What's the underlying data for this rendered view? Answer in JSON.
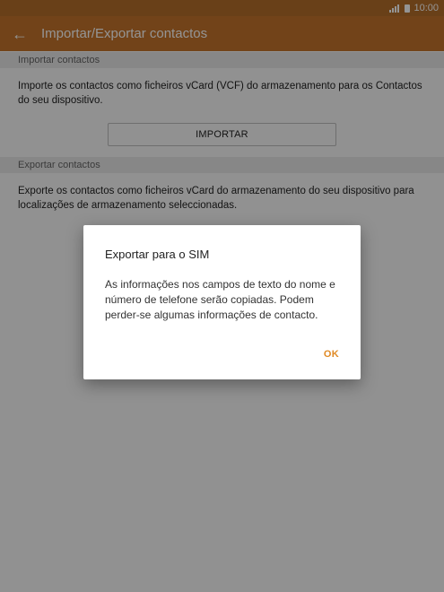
{
  "status_bar": {
    "time": "10:00",
    "signal_icon": "signal-icon",
    "battery_icon": "battery-icon"
  },
  "app_bar": {
    "back_icon": "arrow-left-icon",
    "title": "Importar/Exportar contactos",
    "color": "#c4742b"
  },
  "import_section": {
    "header": "Importar contactos",
    "description": "Importe os contactos como ficheiros vCard (VCF) do armazenamento para os Contactos do seu dispositivo.",
    "button_label": "IMPORTAR"
  },
  "export_section": {
    "header": "Exportar contactos",
    "description": "Exporte os contactos como ficheiros vCard do armazenamento do seu dispositivo para localizações de armazenamento seleccionadas."
  },
  "dialog": {
    "title": "Exportar para o SIM",
    "body": "As informações nos campos de texto do nome e número de telefone serão copiadas. Podem perder-se algumas informações de contacto.",
    "ok_label": "OK",
    "accent": "#e08a25"
  }
}
